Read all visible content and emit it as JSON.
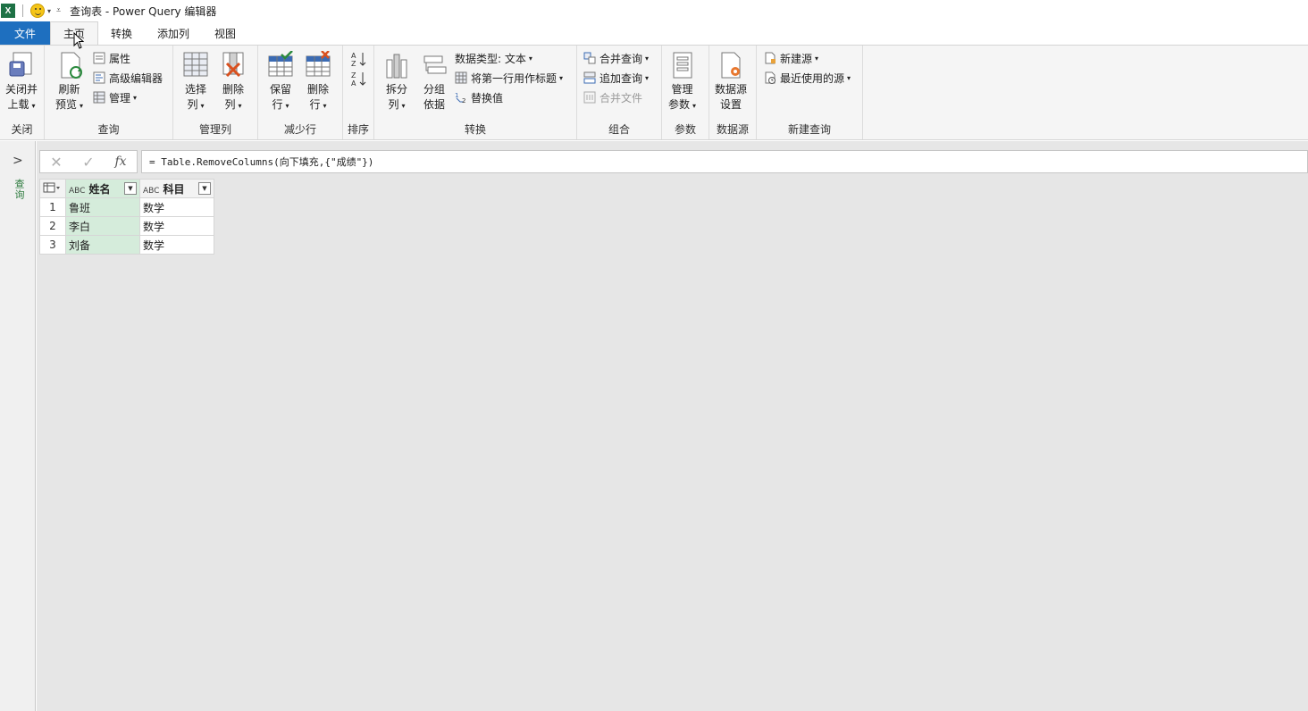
{
  "window": {
    "title": "查询表 - Power Query 编辑器",
    "app_badge": "X"
  },
  "tabs": [
    {
      "label": "文件"
    },
    {
      "label": "主页"
    },
    {
      "label": "转换"
    },
    {
      "label": "添加列"
    },
    {
      "label": "视图"
    }
  ],
  "ribbon": {
    "close": {
      "group": "关闭",
      "close_load": [
        "关闭并",
        "上载"
      ]
    },
    "query": {
      "group": "查询",
      "refresh": [
        "刷新",
        "预览"
      ],
      "properties": "属性",
      "advanced_editor": "高级编辑器",
      "manage": "管理"
    },
    "manage_cols": {
      "group": "管理列",
      "choose_cols": [
        "选择",
        "列"
      ],
      "remove_cols": [
        "删除",
        "列"
      ]
    },
    "reduce_rows": {
      "group": "减少行",
      "keep_rows": [
        "保留",
        "行"
      ],
      "remove_rows": [
        "删除",
        "行"
      ]
    },
    "sort": {
      "group": "排序"
    },
    "transform": {
      "group": "转换",
      "split_col": [
        "拆分",
        "列"
      ],
      "group_by": [
        "分组",
        "依据"
      ],
      "data_type": "数据类型: 文本",
      "use_first_row": "将第一行用作标题",
      "replace_values": "替换值"
    },
    "combine": {
      "group": "组合",
      "merge_queries": "合并查询",
      "append_queries": "追加查询",
      "combine_files": "合并文件"
    },
    "params": {
      "group": "参数",
      "manage_params": [
        "管理",
        "参数"
      ]
    },
    "datasource": {
      "group": "数据源",
      "settings": [
        "数据源",
        "设置"
      ]
    },
    "new_query": {
      "group": "新建查询",
      "new_source": "新建源",
      "recent_sources": "最近使用的源"
    }
  },
  "left_pane": {
    "label": "查询"
  },
  "formula": {
    "text": "= Table.RemoveColumns(向下填充,{\"成绩\"})"
  },
  "table": {
    "columns": [
      {
        "type": "ABC",
        "name": "姓名"
      },
      {
        "type": "ABC",
        "name": "科目"
      }
    ],
    "rows": [
      {
        "num": "1",
        "cells": [
          "鲁班",
          "数学"
        ]
      },
      {
        "num": "2",
        "cells": [
          "李白",
          "数学"
        ]
      },
      {
        "num": "3",
        "cells": [
          "刘备",
          "数学"
        ]
      }
    ]
  },
  "colors": {
    "file_tab": "#1e6fbf",
    "selected_column": "#d5ecdb",
    "excel_green": "#1e7145"
  }
}
